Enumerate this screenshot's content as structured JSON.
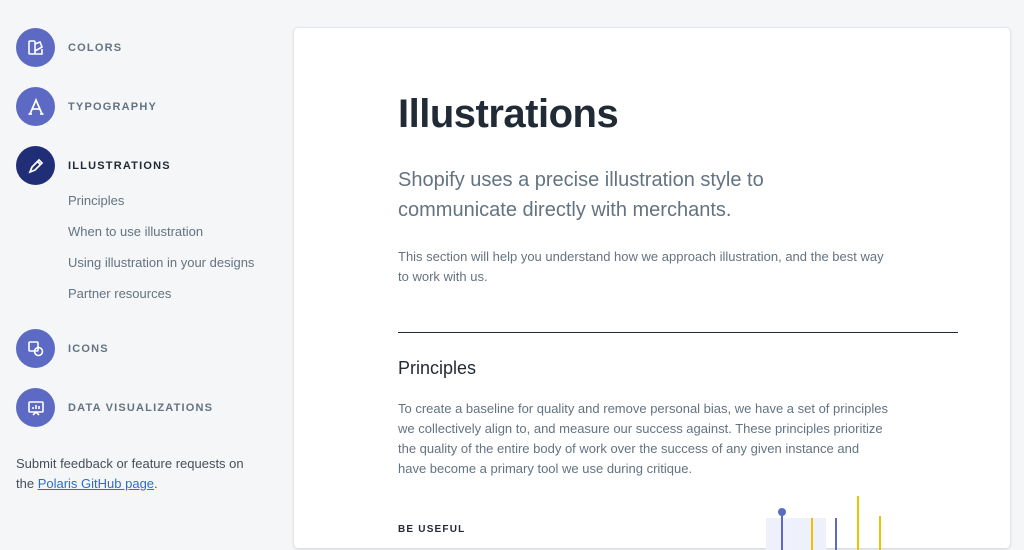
{
  "sidebar": {
    "sections": [
      {
        "label": "COLORS",
        "icon": "colors-icon"
      },
      {
        "label": "TYPOGRAPHY",
        "icon": "typography-icon"
      },
      {
        "label": "ILLUSTRATIONS",
        "icon": "illustrations-icon",
        "active": true
      },
      {
        "label": "ICONS",
        "icon": "icons-icon"
      },
      {
        "label": "DATA VISUALIZATIONS",
        "icon": "data-visualizations-icon"
      }
    ],
    "sub_items": [
      "Principles",
      "When to use illustration",
      "Using illustration in your designs",
      "Partner resources"
    ],
    "feedback": {
      "text_before": "Submit feedback or feature requests on the ",
      "link": "Polaris GitHub page",
      "text_after": "."
    }
  },
  "content": {
    "title": "Illustrations",
    "lead": "Shopify uses a precise illustration style to communicate directly with merchants.",
    "intro": "This section will help you understand how we approach illustration, and the best way to work with us.",
    "principles_heading": "Principles",
    "principles_body": "To create a baseline for quality and remove personal bias, we have a set of principles we collectively align to, and measure our success against. These principles prioritize the quality of the entire body of work over the success of any given instance and have become a primary tool we use during critique.",
    "subheading": "BE USEFUL"
  },
  "colors": {
    "accent": "#5c6ac4",
    "accent_active": "#202e78",
    "background": "#f4f6f8",
    "link": "#2c6ecb",
    "illustration_yellow": "#eec200"
  }
}
